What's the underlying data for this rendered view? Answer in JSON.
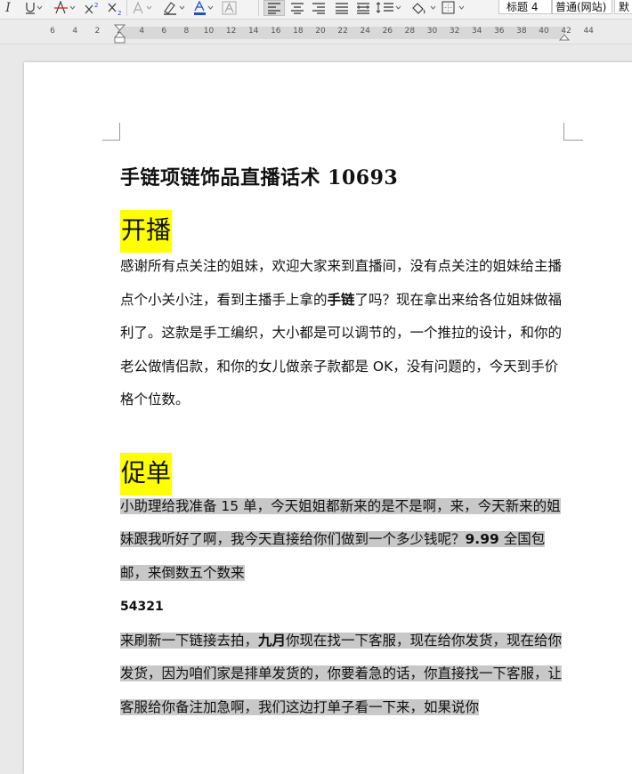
{
  "toolbar": {
    "italic_label": "I",
    "style_heading4": "标题 4",
    "style_web": "普通(网站)",
    "style_default": "默"
  },
  "ruler": {
    "numbers": [
      "6",
      "4",
      "2",
      "2",
      "4",
      "6",
      "8",
      "10",
      "12",
      "14",
      "16",
      "18",
      "20",
      "22",
      "24",
      "26",
      "28",
      "30",
      "32",
      "34",
      "36",
      "38",
      "40",
      "42",
      "44"
    ]
  },
  "document": {
    "title": "手链项链饰品直播话术 10693",
    "section1": {
      "heading": "开播",
      "para": {
        "before_bold": "感谢所有点关注的姐妹，欢迎大家来到直播间，没有点关注的姐妹给主播点个小关小注，看到主播手上拿的",
        "bold": "手链",
        "after_bold": "了吗？现在拿出来给各位姐妹做福利了。这款是手工编织，大小都是可以调节的，一个推拉的设计，和你的老公做情侣款，和你的女儿做亲子款都是 OK，没有问题的，今天到手价格个位数。"
      }
    },
    "section2": {
      "heading": "促单",
      "para1": {
        "before_bold": "小助理给我准备 15 单，今天姐姐都新来的是不是啊，来，今天新来的姐妹跟我听好了啊，我今天直接给你们做到一个多少钱呢？",
        "bold": "9.99",
        "after_bold": " 全国包邮，来倒数五个数来"
      },
      "countdown": "54321",
      "para2": {
        "before_bold": "来刷新一下链接去拍，",
        "bold": "九月",
        "after_bold": "你现在找一下客服，现在给你发货，现在给你发货，因为咱们家是排单发货的，你要着急的话，你直接找一下客服，让客服给你备注加急啊，我们这边打单子看一下来，如果说你"
      }
    }
  },
  "colors": {
    "highlight_yellow": "#ffff00",
    "shading_gray": "#c8c8c8",
    "font_color_red": "#d9252a",
    "font_color_blue": "#1f4fd1"
  }
}
